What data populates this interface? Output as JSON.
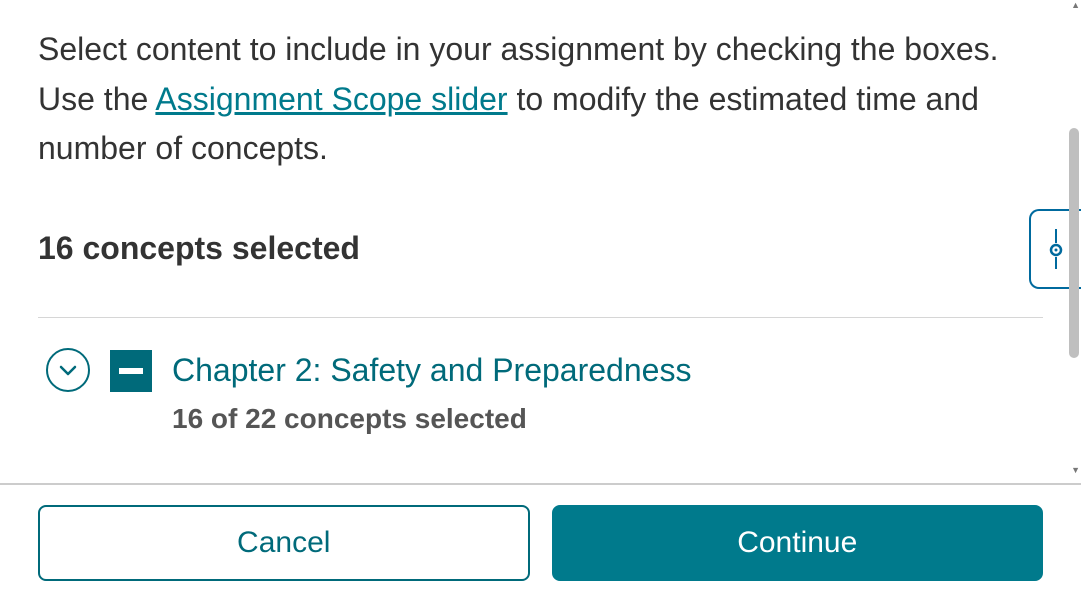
{
  "intro": {
    "text_before": "Select content to include in your assignment by checking the boxes. Use the ",
    "link_text": "Assignment Scope slider",
    "text_after": " to modify the estimated time and number of concepts."
  },
  "selected_summary": "16 concepts selected",
  "chapter": {
    "title": "Chapter 2: Safety and Preparedness",
    "count_text": "16 of 22 concepts selected"
  },
  "buttons": {
    "cancel": "Cancel",
    "continue": "Continue"
  }
}
